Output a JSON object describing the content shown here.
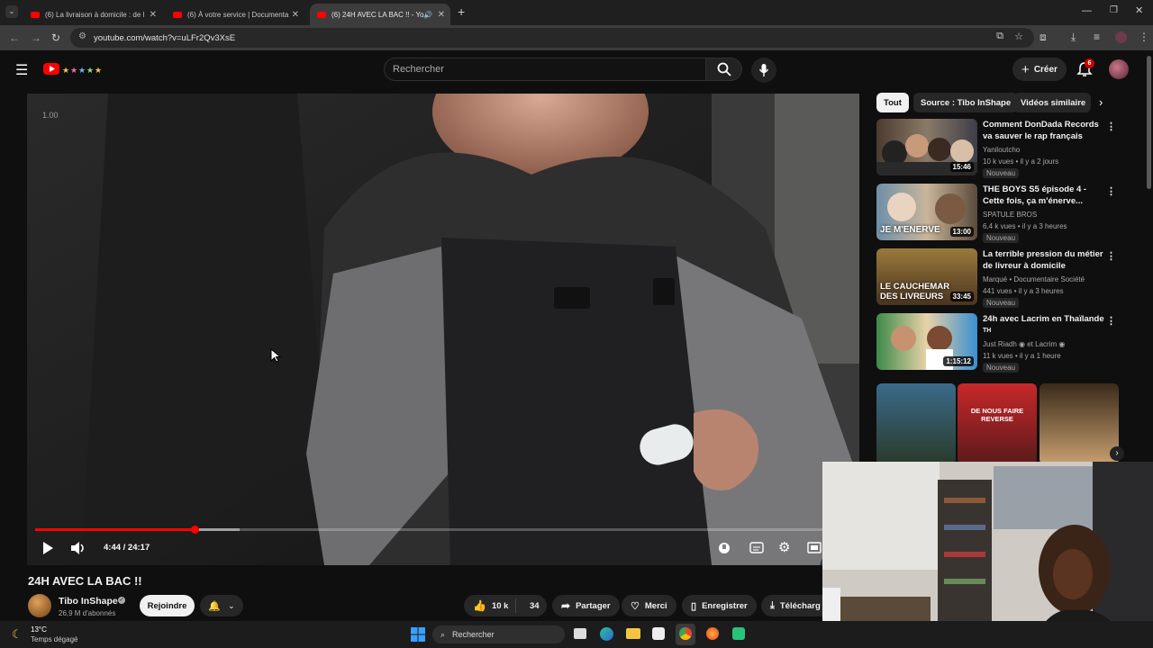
{
  "browser": {
    "tabs": [
      {
        "label": "(6) La livraison à domicile : de l"
      },
      {
        "label": "(6) À votre service | Documenta"
      },
      {
        "label": "(6) 24H AVEC LA BAC !! - Yo"
      }
    ],
    "url": "youtube.com/watch?v=uLFr2Qv3XsE"
  },
  "header": {
    "search_placeholder": "Rechercher",
    "create_label": "Créer",
    "notif_count": "6"
  },
  "player": {
    "overlay_label": "1.00",
    "time": "4:44 / 24:17",
    "progress": 0.195,
    "buffered": 0.25
  },
  "video": {
    "title": "24H AVEC LA BAC !!",
    "channel": "Tibo InShape",
    "subscribers": "26,9 M d'abonnés",
    "join_label": "Rejoindre",
    "likes": "10 k",
    "dislikes": "34",
    "share_label": "Partager",
    "thanks_label": "Merci",
    "save_label": "Enregistrer",
    "download_label": "Télécharg"
  },
  "filters": [
    {
      "label": "Tout"
    },
    {
      "label": "Source : Tibo InShape"
    },
    {
      "label": "Vidéos similaire"
    }
  ],
  "recommendations": [
    {
      "title": "Comment DonDada Records va sauver le rap français",
      "channel": "Yaniloutcho",
      "meta": "10 k vues • il y a 2 jours",
      "badge": "Nouveau",
      "duration": "15:46"
    },
    {
      "title": "THE BOYS S5 épisode 4 - Cette fois, ça m'énerve...",
      "channel": "SPATULE BROS",
      "meta": "6,4 k vues • il y a 3 heures",
      "badge": "Nouveau",
      "duration": "13:00",
      "thumb_text": "JE M'ENERVE"
    },
    {
      "title": "La terrible pression du métier de livreur à domicile",
      "channel": "Marqué • Documentaire Société",
      "meta": "441 vues • il y a 3 heures",
      "badge": "Nouveau",
      "duration": "33:45",
      "thumb_text": "LE CAUCHEMAR DES LIVREURS"
    },
    {
      "title": "24h avec Lacrim en Thaïlande",
      "title_extra": "TH",
      "channel": "Just Riadh ◉ et Lacrim ◉",
      "meta": "11 k vues • il y a 1 heure",
      "badge": "Nouveau",
      "duration": "1:15:12"
    }
  ],
  "shorts": [
    {
      "thumb_text": ""
    },
    {
      "thumb_text": "DE NOUS FAIRE REVERSE"
    },
    {
      "thumb_text": ""
    }
  ],
  "taskbar": {
    "temperature": "13°C",
    "weather": "Temps dégagé",
    "search_label": "Rechercher"
  }
}
